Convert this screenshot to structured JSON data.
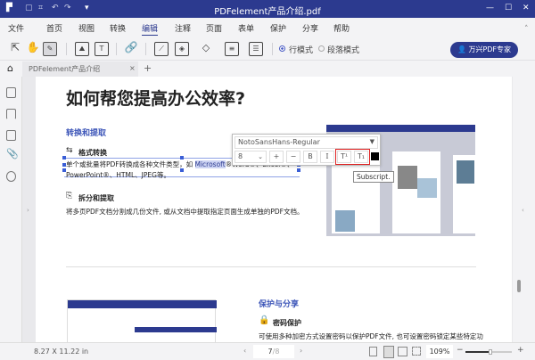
{
  "window": {
    "title": "PDFelement产品介绍.pdf"
  },
  "menu": [
    "文件",
    "首页",
    "视图",
    "转换",
    "编辑",
    "注释",
    "页面",
    "表单",
    "保护",
    "分享",
    "帮助"
  ],
  "menu_active": "编辑",
  "toolbar": {
    "mode_line": "行模式",
    "mode_paragraph": "段落模式",
    "expert_button": "万兴PDF专家"
  },
  "tab": {
    "label": "PDFelement产品介绍",
    "close": "×",
    "add": "+"
  },
  "document": {
    "title": "如何帮您提高办公效率?",
    "section1": "转换和提取",
    "item1_title": "格式转换",
    "item1_text_a": "单个或批量将PDF转换成各种文件类型，如 ",
    "item1_text_hl": "Microsoft",
    "item1_text_b": "®Word®、Excel®、",
    "item1_text_c": "PowerPoint®、HTML、JPEG等。",
    "item2_title": "拆分和提取",
    "item2_text": "将多页PDF文档分割成几份文件, 或从文档中提取指定页面生成单独的PDF文档。",
    "section2": "保护与分享",
    "item3_title": "密码保护",
    "item3_text": "可使用多种加密方式设置密码以保护PDF文件, 也可设置密码锁定某些特定功"
  },
  "font_popup": {
    "font": "NotoSansHans-Regular",
    "size": "8",
    "plus": "+",
    "minus": "−",
    "bold": "B",
    "italic": "I",
    "superscript": "T¹",
    "subscript": "T₁",
    "color": "#000000"
  },
  "tooltip": "Subscript.",
  "status": {
    "page_size": "8.27 X 11.22 in",
    "current_page": "7",
    "total_pages": "/8",
    "zoom": "109%",
    "zoom_minus": "−",
    "zoom_plus": "+"
  },
  "colors": {
    "titlebar": "#2c3a8f",
    "accent": "#3c55b8",
    "highlight_box": "#e02020"
  }
}
